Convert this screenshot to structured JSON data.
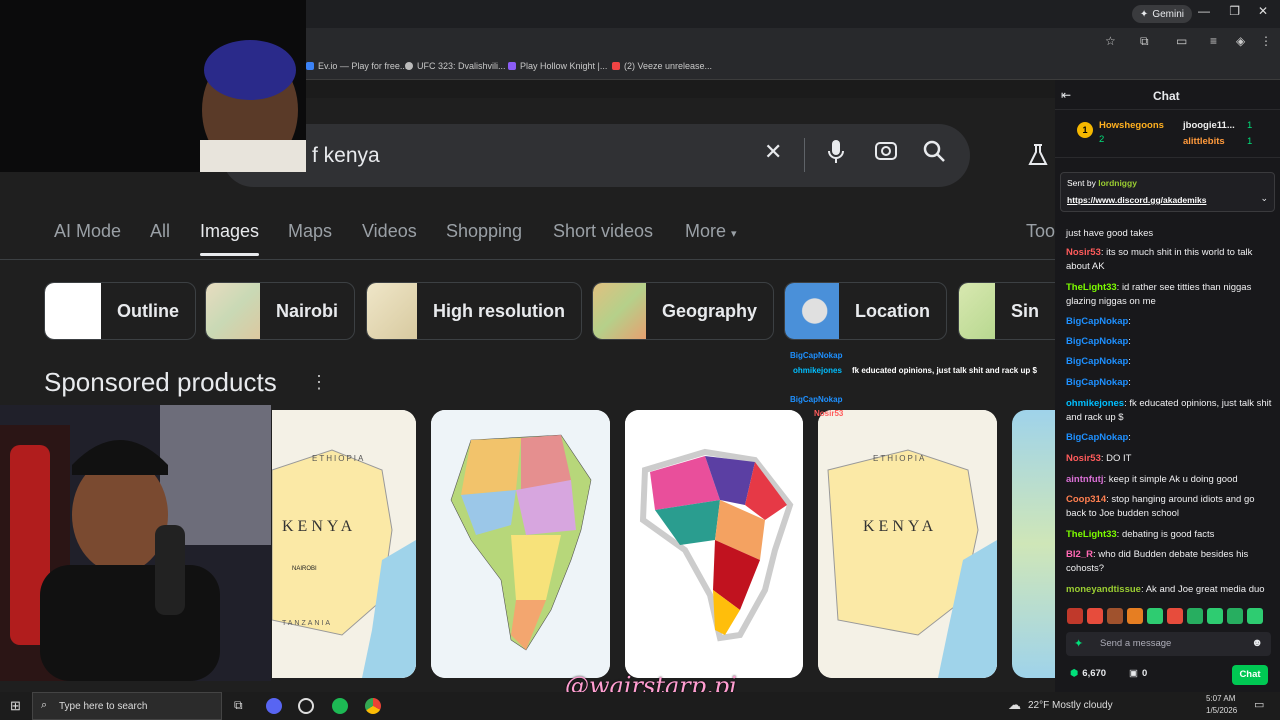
{
  "browser": {
    "gemini_label": "Gemini",
    "bookmarks": [
      "Ev.io — Play for free...",
      "UFC 323: Dvalishvili...",
      "Play Hollow Knight |...",
      "(2) Veeze unrelease..."
    ]
  },
  "search": {
    "query": "f kenya"
  },
  "tabs": [
    "AI Mode",
    "All",
    "Images",
    "Maps",
    "Videos",
    "Shopping",
    "Short videos",
    "More",
    "Too"
  ],
  "chips": [
    "Outline",
    "Nairobi",
    "High resolution",
    "Geography",
    "Location",
    "Sin"
  ],
  "sponsored": {
    "title": "Sponsored products"
  },
  "cards": {
    "card1_text": "KENYA",
    "card1_city": "NAIROBI",
    "card1_top": "ETHIOPIA",
    "card1_bottom": "TANZANIA",
    "card4_text": "KENYA",
    "card4_top": "ETHIOPIA"
  },
  "overlay_chat": [
    {
      "user": "BigCapNokap",
      "text": ""
    },
    {
      "user": "ohmikejones",
      "text": "fk educated opinions, just talk shit and rack up $"
    },
    {
      "user": "BigCapNokap",
      "text": ""
    },
    {
      "user": "Nosir53",
      "text": ""
    }
  ],
  "watermark": "@wairstarp.pi",
  "chat": {
    "title": "Chat",
    "top_gifters": [
      {
        "name": "Howshegoons",
        "count": "2"
      },
      {
        "name": "jboogie11...",
        "count": "1"
      },
      {
        "name": "alittlebits",
        "count": "1"
      }
    ],
    "pinned": {
      "sent_by_label": "Sent by",
      "user": "lordniggy",
      "link": "https://www.discord.gg/akademiks"
    },
    "messages": [
      {
        "user": "",
        "color": "#efeff1",
        "text": "just have good takes"
      },
      {
        "user": "Nosir53",
        "color": "#ff5b5b",
        "text": ": its so much shit in this world to talk about AK"
      },
      {
        "user": "TheLight33",
        "color": "#7cfc00",
        "text": ": id rather see titties than niggas glazing niggas on me"
      },
      {
        "user": "BigCapNokap",
        "color": "#1e90ff",
        "text": ":"
      },
      {
        "user": "BigCapNokap",
        "color": "#1e90ff",
        "text": ":"
      },
      {
        "user": "BigCapNokap",
        "color": "#1e90ff",
        "text": ":"
      },
      {
        "user": "BigCapNokap",
        "color": "#1e90ff",
        "text": ":"
      },
      {
        "user": "ohmikejones",
        "color": "#00bfff",
        "text": ": fk educated opinions, just talk shit and rack up $"
      },
      {
        "user": "BigCapNokap",
        "color": "#1e90ff",
        "text": ":"
      },
      {
        "user": "Nosir53",
        "color": "#ff5b5b",
        "text": ": DO IT"
      },
      {
        "user": "aintnfutj",
        "color": "#da70d6",
        "text": ": keep it simple Ak u doing good"
      },
      {
        "user": "Coop314",
        "color": "#ff7f50",
        "text": ": stop hanging around idiots and go back to Joe budden school"
      },
      {
        "user": "TheLight33",
        "color": "#7cfc00",
        "text": ": debating is good facts"
      },
      {
        "user": "BI2_R",
        "color": "#ff69b4",
        "text": ": who did Budden debate besides his cohosts?"
      },
      {
        "user": "moneyandtissue",
        "color": "#9acd32",
        "text": ": Ak and Joe great media duo"
      }
    ],
    "input_placeholder": "Send a message",
    "points": "6,670",
    "gift_count": "0",
    "chat_button": "Chat"
  },
  "taskbar": {
    "search_placeholder": "Type here to search",
    "weather_temp": "22°F",
    "weather_desc": "Mostly cloudy",
    "time": "5:07 AM",
    "date": "1/5/2026"
  }
}
